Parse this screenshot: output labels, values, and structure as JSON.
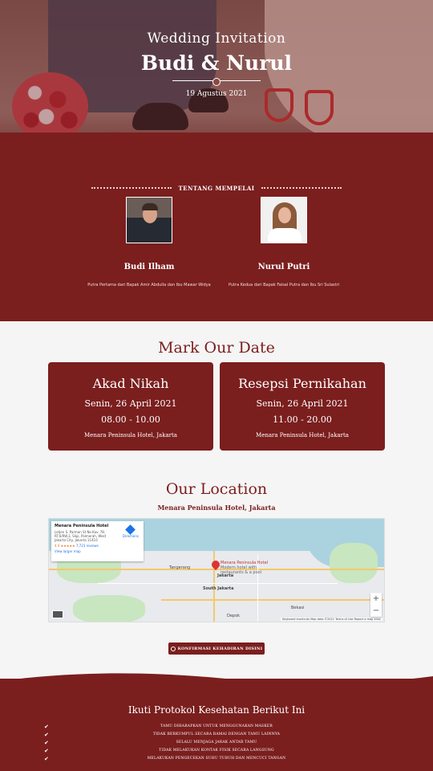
{
  "hero": {
    "subtitle": "Wedding Invitation",
    "names": "Budi & Nurul",
    "date": "19 Agustus 2021"
  },
  "couple": {
    "heading": "TENTANG MEMPELAI",
    "groom": {
      "name": "Budi Ilham",
      "desc": "Putra Pertama dari Bapak Amir Abdulla dan Ibu Mawar Widya"
    },
    "bride": {
      "name": "Nurul Putri",
      "desc": "Putra Kedua dari Bapak Faisal Putra dan Ibu Sri Sulastri"
    }
  },
  "dates": {
    "title": "Mark Our Date",
    "akad": {
      "title": "Akad Nikah",
      "date": "Senin, 26 April 2021",
      "time": "08.00 - 10.00",
      "venue": "Menara Peninsula Hotel, Jakarta"
    },
    "resepsi": {
      "title": "Resepsi Pernikahan",
      "date": "Senin, 26 April 2021",
      "time": "11.00 - 20.00",
      "venue": "Menara Peninsula Hotel, Jakarta"
    }
  },
  "location": {
    "title": "Our Location",
    "venue": "Menara Peninsula Hotel, Jakarta",
    "map": {
      "card_title": "Menara Peninsula Hotel",
      "card_address": "Letjen S. Parman St No.Kav. 78, RT.6/RW.3, Slipi, Palmerah, West Jakarta City, Jakarta 11410",
      "rating": "4.4 ★★★★★",
      "reviews": "7,723 reviews",
      "view_larger": "View larger map",
      "directions": "Directions",
      "pin_label": "Menara Peninsula Hotel",
      "pin_sub": "Modern hotel with restaurants & a pool",
      "labels": [
        "Tangerang",
        "Jakarta",
        "South Jakarta",
        "Bekasi",
        "Depok"
      ],
      "zoom_in": "+",
      "zoom_out": "−",
      "footer": "Keyboard shortcuts   Map data ©2021   Terms of Use   Report a map error"
    },
    "rsvp": "KONFIRMASI KEHADIRAN DISINI"
  },
  "protocol": {
    "title": "Ikuti Protokol Kesehatan Berikut Ini",
    "check": "✔",
    "rules": [
      "TAMU DIHARAPKAN UNTUK MENGGUNAKAN MASKER",
      "TIDAK BERKUMPUL SECARA RAMAI DENGAN TAMU LAINNYA",
      "SELALU MENJAGA JARAK ANTAR TAMU",
      "TIDAK MELAKUKAN KONTAK FISIK SECARA LANGSUNG",
      "MELAKUKAN PENGECEKAN SUHU TUBUH DAN MENCUCI TANGAN"
    ]
  },
  "colors": {
    "primary": "#7b1e1e",
    "light": "#f5f5f5"
  }
}
